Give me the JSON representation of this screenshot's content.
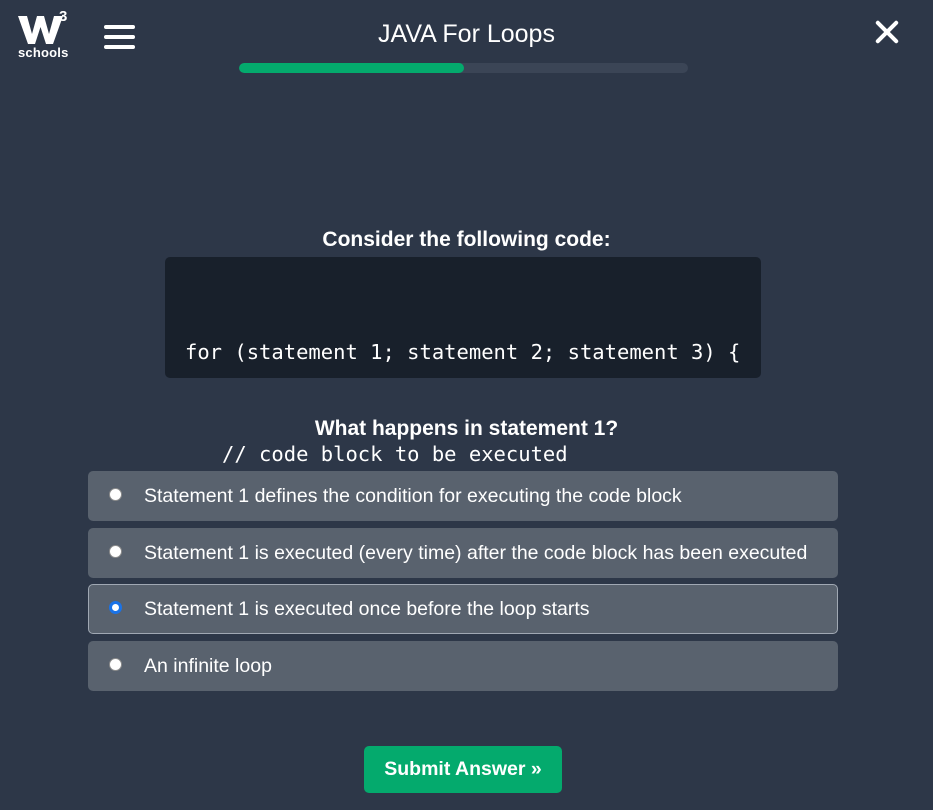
{
  "header": {
    "logo_text": "schools",
    "logo_superscript": "3",
    "title": "JAVA For Loops",
    "progress_fraction": 0.5,
    "accent_color": "#04aa6d",
    "icons": {
      "menu": "hamburger-menu-icon",
      "close": "close-x-icon",
      "logo": "w3schools-logo-icon"
    }
  },
  "quiz": {
    "intro": "Consider the following code:",
    "code_lines": [
      "for (statement 1; statement 2; statement 3) {",
      "   // code block to be executed",
      "}"
    ],
    "question": "What happens in statement 1?",
    "options": [
      {
        "label": "Statement 1 defines the condition for executing the code block",
        "selected": false
      },
      {
        "label": "Statement 1 is executed (every time) after the code block has been executed",
        "selected": false
      },
      {
        "label": "Statement 1 is executed once before the loop starts",
        "selected": true
      },
      {
        "label": "An infinite loop",
        "selected": false
      }
    ],
    "submit_label": "Submit Answer »"
  }
}
